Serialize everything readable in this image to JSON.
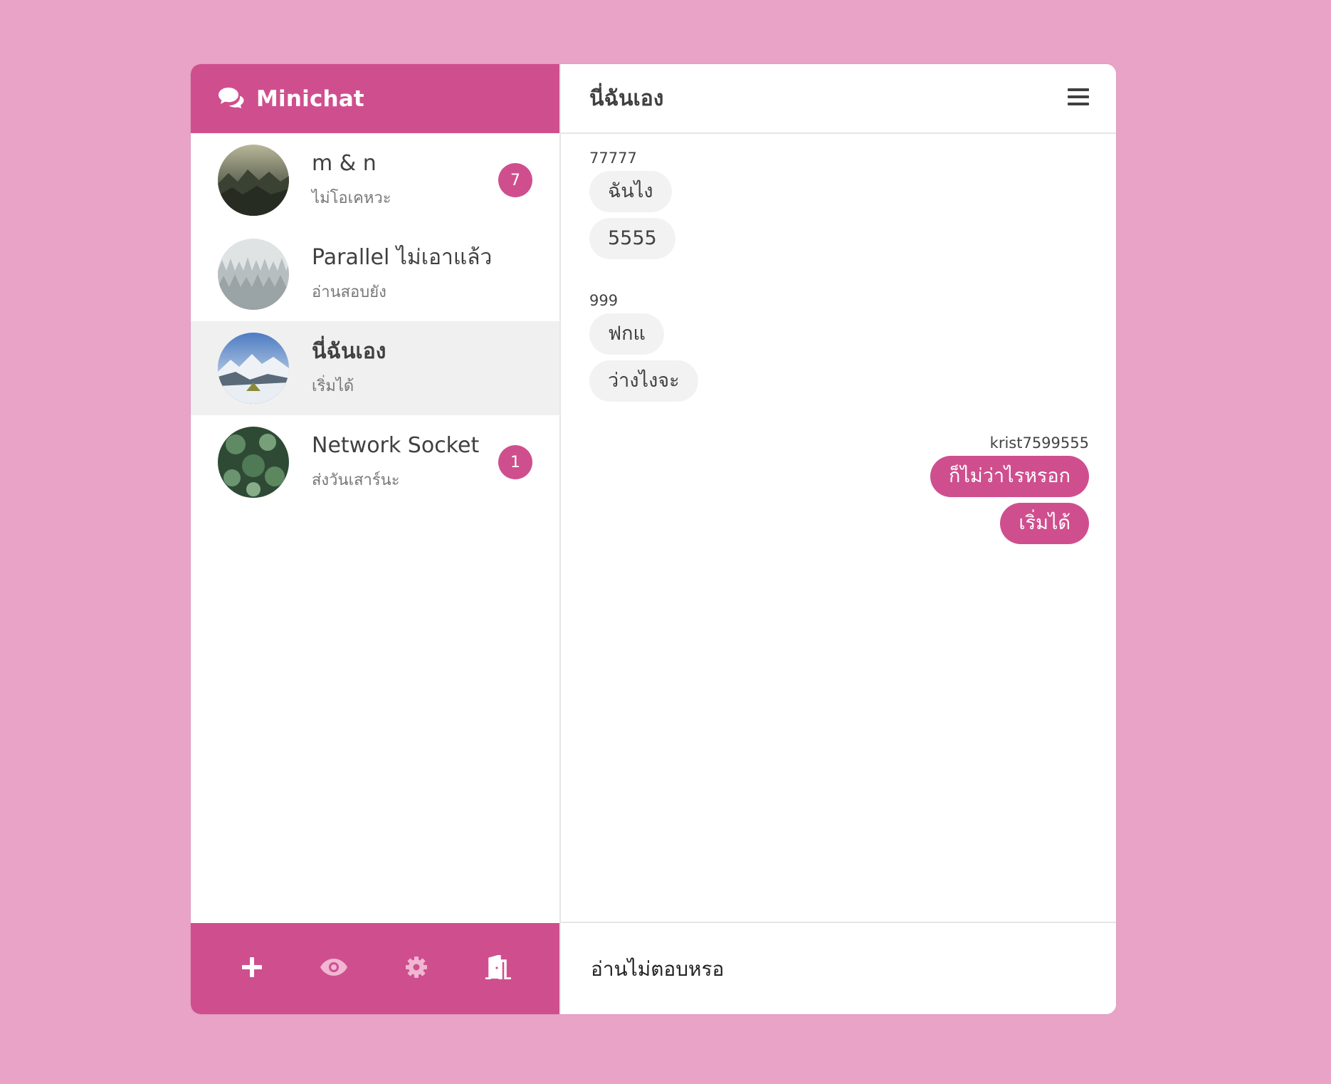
{
  "brand": {
    "name": "Minichat",
    "icon": "chat-bubbles-icon",
    "color": "#cf4f8e"
  },
  "contacts": [
    {
      "name": "m & n",
      "preview": "ไม่โอเคหวะ",
      "badge": "7",
      "avatar": "misty-forest"
    },
    {
      "name": "Parallel ไม่เอาแล้ว",
      "preview": "อ่านสอบยัง",
      "badge": null,
      "avatar": "snowy-trees"
    },
    {
      "name": "นี่ฉันเอง",
      "preview": "เริ่มได้",
      "badge": null,
      "avatar": "snow-mountains",
      "active": true
    },
    {
      "name": "Network Socket",
      "preview": "ส่งวันเสาร์นะ",
      "badge": "1",
      "avatar": "green-plants"
    }
  ],
  "toolbar": {
    "icons": [
      "plus-icon",
      "eye-icon",
      "gear-icon",
      "door-exit-icon"
    ]
  },
  "chat": {
    "title": "นี่ฉันเอง",
    "menu_icon": "hamburger-menu-icon",
    "groups": [
      {
        "sender": "77777",
        "mine": false,
        "messages": [
          "ฉันไง",
          "5555"
        ]
      },
      {
        "sender": "999",
        "mine": false,
        "messages": [
          "ฟกแ",
          "ว่างไงจะ"
        ]
      },
      {
        "sender": "krist7599555",
        "mine": true,
        "messages": [
          "ก็ไม่ว่าไรหรอก",
          "เริ่มได้"
        ]
      }
    ],
    "input_placeholder": "อ่านไม่ตอบหรอ"
  },
  "colors": {
    "background": "#e8a3c6",
    "accent": "#cf4f8e",
    "bubble_other": "#f2f2f2"
  }
}
